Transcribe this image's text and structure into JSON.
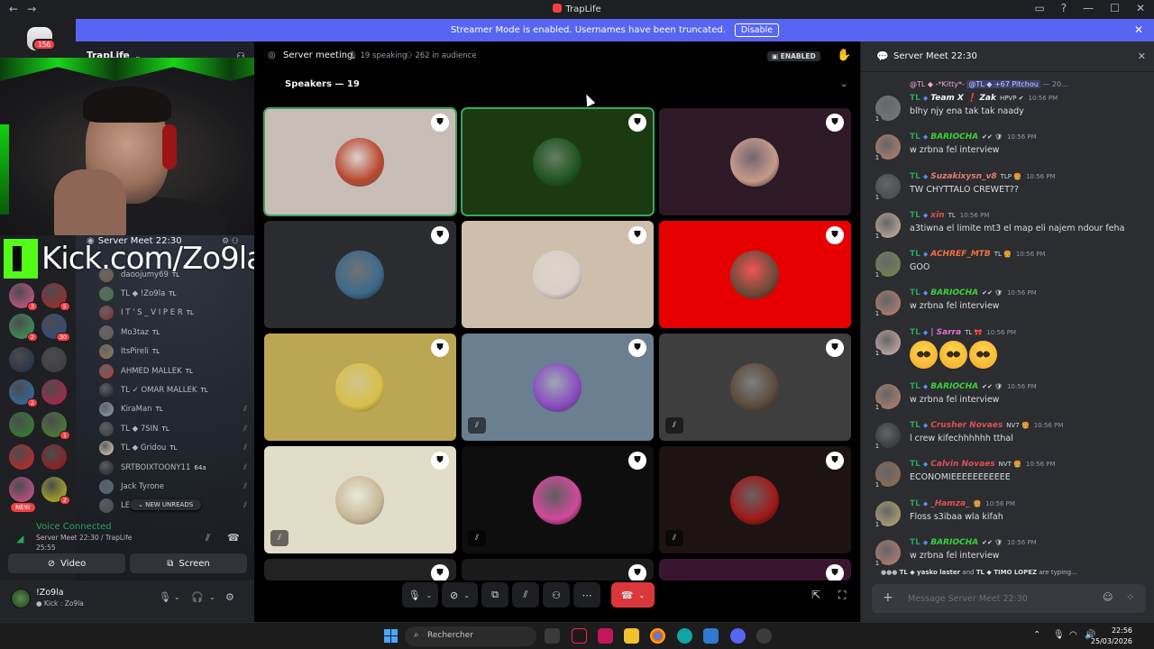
{
  "window": {
    "title": "TrapLife",
    "back_glyph": "←",
    "forward_glyph": "→",
    "controls": [
      "▭",
      "?",
      "—",
      "☐",
      "✕"
    ]
  },
  "banner": {
    "text": "Streamer Mode is enabled. Usernames have been truncated.",
    "button": "Disable",
    "close": "✕"
  },
  "rail": {
    "home_badge": "156",
    "new_label": "NEW",
    "servers": [
      {
        "color": "#d65b3c",
        "count": ""
      },
      {
        "color": "#3d7a3a",
        "count": ""
      },
      {
        "color": "#e0558f",
        "count": "3"
      },
      {
        "color": "#b22424",
        "count": "5"
      },
      {
        "color": "#3aa05a",
        "count": "2"
      },
      {
        "color": "#2b4b8a",
        "count": "30"
      },
      {
        "color": "#1f2a44",
        "count": ""
      },
      {
        "color": "#3a3a3a",
        "count": ""
      },
      {
        "color": "#2d6fb0",
        "count": "2"
      },
      {
        "color": "#c01c4a",
        "count": ""
      },
      {
        "color": "#2f8a2a",
        "count": ""
      },
      {
        "color": "#4a8a2a",
        "count": "1"
      },
      {
        "color": "#d02020",
        "count": ""
      },
      {
        "color": "#a01010",
        "count": ""
      },
      {
        "color": "#e05090",
        "count": ""
      },
      {
        "color": "#c4c41a",
        "count": "2"
      }
    ]
  },
  "sidebar": {
    "server_name": "TrapLife",
    "chevron": "⌄",
    "voice_channel": "Server Meet 22:30",
    "members": [
      {
        "name": "daoojumy69",
        "tag": "TL",
        "color": "#7a5b3a",
        "muted": false
      },
      {
        "name": "TL ◆ !Zo9la",
        "tag": "TL",
        "color": "#3d7a3a",
        "muted": false
      },
      {
        "name": "I T ' S _ V I P E R",
        "tag": "TL",
        "color": "#8a2a2a",
        "muted": false
      },
      {
        "name": "Mo3taz",
        "tag": "TL",
        "color": "#6b5a4a",
        "muted": false
      },
      {
        "name": "ItsPireli",
        "tag": "TL",
        "color": "#9a7a4a",
        "muted": false
      },
      {
        "name": "AHMED MALLEK",
        "tag": "TL",
        "color": "#c0392b",
        "muted": false
      },
      {
        "name": "TL ✓ OMAR MALLEK",
        "tag": "TL",
        "color": "#1e1f22",
        "muted": false
      },
      {
        "name": "KiraMan",
        "tag": "TL",
        "color": "#8aa0b0",
        "muted": true
      },
      {
        "name": "TL ◆ 7SIN",
        "tag": "TL",
        "color": "#3a3a3a",
        "muted": true
      },
      {
        "name": "TL ◆ Gridou",
        "tag": "TL",
        "color": "#e0d0b0",
        "muted": true
      },
      {
        "name": "SRTBOIXTOONY11",
        "tag": "64a",
        "color": "#222",
        "muted": true
      },
      {
        "name": "Jack Tyrone",
        "tag": "",
        "color": "#5a6a7a",
        "muted": true
      },
      {
        "name": "LEF",
        "tag": "",
        "color": "#4a4a4a",
        "muted": true
      }
    ],
    "new_unreads": "NEW UNREADS",
    "voice_status": {
      "title": "Voice Connected",
      "subtitle": "Server Meet 22:30 / TrapLife",
      "elapsed": "25:55"
    },
    "video_button": "Video",
    "screen_button": "Screen",
    "user": {
      "name": "!Zo9la",
      "status": "● Kick : Zo9la"
    }
  },
  "overlay": {
    "kick_url": "Kick.com/Zo9la"
  },
  "stage": {
    "title": "Server meeting",
    "speaking": "19 speaking",
    "audience": "262 in audience",
    "enabled_badge": "ENABLED",
    "section": "Speakers — 19",
    "tiles": [
      {
        "bg": "#c9bdb8",
        "avatar": "#b9472f",
        "speaking": true,
        "muted": false
      },
      {
        "bg": "#1b3a12",
        "avatar": "#1f5424",
        "speaking": true,
        "muted": false
      },
      {
        "bg": "#2d1a26",
        "avatar": "#c79b8a",
        "speaking": false,
        "muted": false
      },
      {
        "bg": "#2a2c30",
        "avatar": "#3c6a8a",
        "speaking": false,
        "muted": false
      },
      {
        "bg": "#cdbfab",
        "avatar": "#d8cfc8",
        "speaking": false,
        "muted": false
      },
      {
        "bg": "#e60000",
        "avatar": "#6b4a3a",
        "speaking": false,
        "muted": false
      },
      {
        "bg": "#bba654",
        "avatar": "#d8c04a",
        "speaking": false,
        "muted": false
      },
      {
        "bg": "#6a7f8f",
        "avatar": "#8a4ac0",
        "speaking": false,
        "muted": true
      },
      {
        "bg": "#3e3e3e",
        "avatar": "#5a4a3a",
        "speaking": false,
        "muted": true
      },
      {
        "bg": "#e2ddc8",
        "avatar": "#c8b898",
        "speaking": false,
        "muted": true
      },
      {
        "bg": "#0e0e0e",
        "avatar": "#d04a9a",
        "speaking": false,
        "muted": true
      },
      {
        "bg": "#1e1313",
        "avatar": "#a01818",
        "speaking": false,
        "muted": true
      },
      {
        "bg": "#222",
        "avatar": "#333",
        "speaking": false,
        "muted": false
      },
      {
        "bg": "#1a1a1a",
        "avatar": "#333",
        "speaking": false,
        "muted": false
      },
      {
        "bg": "#3a1530",
        "avatar": "#5a2a4a",
        "speaking": false,
        "muted": false
      }
    ]
  },
  "chat": {
    "title": "Server Meet 22:30",
    "reply_line": {
      "prefix": "@TL ◆ -*Kitty*-",
      "mention": "@TL ◆ +67 Pitchou",
      "suffix": "— 20..."
    },
    "messages": [
      {
        "name": "Team X ❗ Zak",
        "name_color": "#f2f3f5",
        "badge": "HPVP ✔",
        "time": "10:56 PM",
        "text": "blhy njy ena tak tak naady",
        "avatar": "#7a7a7a",
        "emoji": false
      },
      {
        "name": "BARIOCHA",
        "name_color": "#38d438",
        "badge": "✔✔ 🛡",
        "time": "10:56 PM",
        "text": "w zrbna fel interview",
        "avatar": "#c0826a",
        "emoji": false
      },
      {
        "name": "Suzakixysn_v8",
        "name_color": "#e67e6e",
        "badge": "TLP 🍔",
        "time": "10:56 PM",
        "text": "TW CHYTTALO CREWET??",
        "avatar": "#444",
        "emoji": false
      },
      {
        "name": "xin",
        "name_color": "#e05050",
        "badge": "TL",
        "time": "10:56 PM",
        "text": "a3tiwna el limite mt3 el map eli najem ndour feha",
        "avatar": "#d0b8a0",
        "emoji": false
      },
      {
        "name": "ACHREF_MTB",
        "name_color": "#f07040",
        "badge": "TL 🍔",
        "time": "10:56 PM",
        "text": "GOO",
        "avatar": "#7a8a4a",
        "emoji": false
      },
      {
        "name": "BARIOCHA",
        "name_color": "#38d438",
        "badge": "✔✔ 🛡",
        "time": "10:56 PM",
        "text": "w zrbna fel interview",
        "avatar": "#c0826a",
        "emoji": false
      },
      {
        "name": "| Sarra",
        "name_color": "#e870d0",
        "badge": "TL 🎀",
        "time": "10:56 PM",
        "text": "",
        "avatar": "#d8b8b0",
        "emoji": true
      },
      {
        "name": "BARIOCHA",
        "name_color": "#38d438",
        "badge": "✔✔ 🛡",
        "time": "10:56 PM",
        "text": "w zrbna fel interview",
        "avatar": "#c0826a",
        "emoji": false
      },
      {
        "name": "Crusher Novaes",
        "name_color": "#e05050",
        "badge": "NV7 🍔",
        "time": "10:56 PM",
        "text": "l crew kifechhhhhh tthal",
        "avatar": "#2a2a2a",
        "emoji": false
      },
      {
        "name": "Calvin Novaes",
        "name_color": "#e05050",
        "badge": "NVT 🍔",
        "time": "10:56 PM",
        "text": "ECONOMIEEEEEEEEEEE",
        "avatar": "#9a6a4a",
        "emoji": false
      },
      {
        "name": "_Hamza_",
        "name_color": "#e05050",
        "badge": "🍔",
        "time": "10:56 PM",
        "text": "Floss s3ibaa wla kifah",
        "avatar": "#c0b070",
        "emoji": false
      },
      {
        "name": "BARIOCHA",
        "name_color": "#38d438",
        "badge": "✔✔ 🛡",
        "time": "10:56 PM",
        "text": "w zrbna fel interview",
        "avatar": "#c0826a",
        "emoji": false
      }
    ],
    "typing": {
      "user1": "TL ◆ yasko laster",
      "and": "and",
      "user2": "TL ◆ TIMO LOPEZ",
      "suffix": "are typing..."
    },
    "composer_placeholder": "Message Server Meet 22:30"
  },
  "taskbar": {
    "search": "Rechercher",
    "time": "22:56",
    "date": "25/03/2026"
  }
}
